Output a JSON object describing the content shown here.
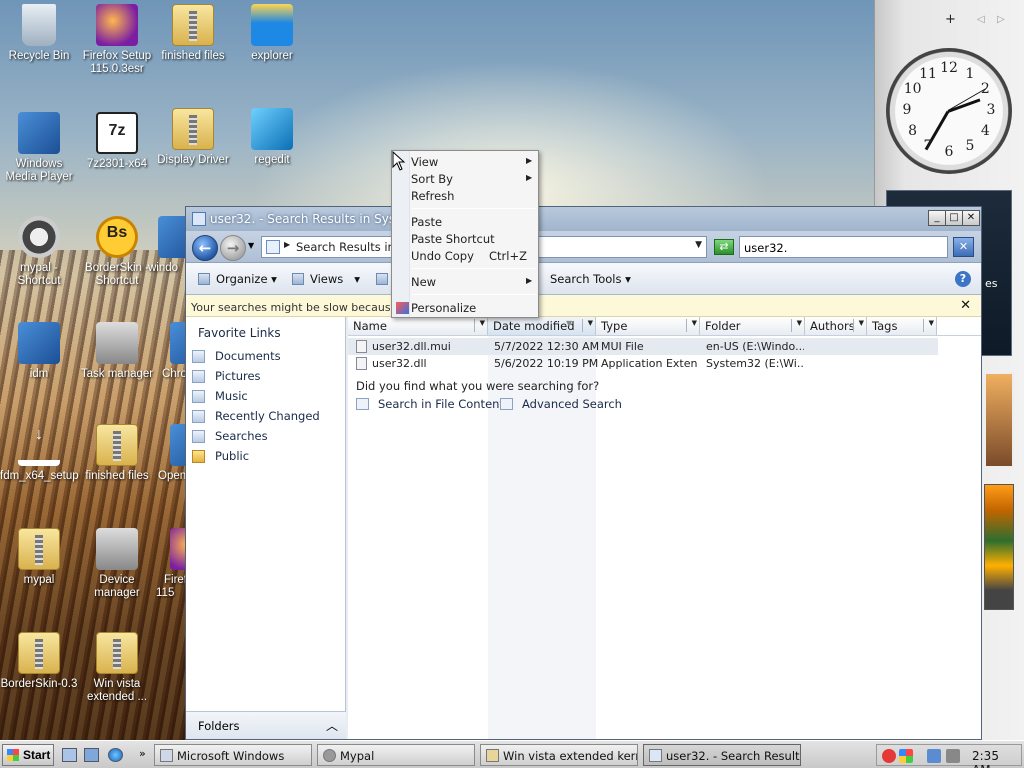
{
  "desktop": {
    "icons": [
      {
        "label": "Recycle Bin"
      },
      {
        "label": "Firefox Setup 115.0.3esr"
      },
      {
        "label": "finished files"
      },
      {
        "label": "explorer"
      },
      {
        "label": "Windows Media Player"
      },
      {
        "label": "7z2301-x64"
      },
      {
        "label": "Display Driver"
      },
      {
        "label": "regedit"
      },
      {
        "label": "mypal - Shortcut"
      },
      {
        "label": "BorderSkin - Shortcut"
      },
      {
        "label": "windo"
      },
      {
        "label": "idm"
      },
      {
        "label": "Task manager"
      },
      {
        "label": "Chro"
      },
      {
        "label": "fdm_x64_setup"
      },
      {
        "label": "finished files"
      },
      {
        "label": "Open"
      },
      {
        "label": "mypal"
      },
      {
        "label": "Device manager"
      },
      {
        "label": "Firef 115"
      },
      {
        "label": "BorderSkin-0.3"
      },
      {
        "label": "Win vista extended ..."
      }
    ]
  },
  "sidebar": {
    "add": "+",
    "prev": "◁",
    "next": "▷",
    "clock_numbers": [
      "12",
      "1",
      "2",
      "3",
      "4",
      "5",
      "6",
      "7",
      "8",
      "9",
      "10",
      "11"
    ],
    "dark_gadget_text": "es"
  },
  "window": {
    "title": "user32. - Search Results in System32",
    "address": "Search Results in S",
    "search_value": "user32.",
    "toolbar": {
      "organize": "Organize",
      "views": "Views",
      "search_tools": "Search Tools"
    },
    "infobar": "Your searches might be slow because the                                                              m on the index...",
    "nav": {
      "favorite_links": "Favorite Links",
      "items": [
        "Documents",
        "Pictures",
        "Music",
        "Recently Changed",
        "Searches",
        "Public"
      ],
      "folders": "Folders"
    },
    "columns": [
      "Name",
      "Date modified",
      "Type",
      "Folder",
      "Authors",
      "Tags"
    ],
    "rows": [
      {
        "name": "user32.dll.mui",
        "date": "5/7/2022 12:30 AM",
        "type": "MUI File",
        "folder": "en-US (E:\\Windo..."
      },
      {
        "name": "user32.dll",
        "date": "5/6/2022 10:19 PM",
        "type": "Application Exten...",
        "folder": "System32 (E:\\Wi..."
      }
    ],
    "did_you_find": "Did you find what you were searching for?",
    "search_in_contents": "Search in File Contents",
    "advanced_search": "Advanced Search"
  },
  "context_menu": {
    "items": [
      {
        "label": "View",
        "submenu": true
      },
      {
        "label": "Sort By",
        "submenu": true
      },
      {
        "label": "Refresh"
      },
      {
        "label": "Paste"
      },
      {
        "label": "Paste Shortcut"
      },
      {
        "label": "Undo Copy",
        "shortcut": "Ctrl+Z"
      },
      {
        "label": "New",
        "submenu": true
      },
      {
        "label": "Personalize"
      }
    ]
  },
  "taskbar": {
    "start": "Start",
    "buttons": [
      "Microsoft Windows",
      "Mypal",
      "Win vista extended kernel...",
      "user32. - Search Results i..."
    ],
    "time": "2:35 AM"
  }
}
